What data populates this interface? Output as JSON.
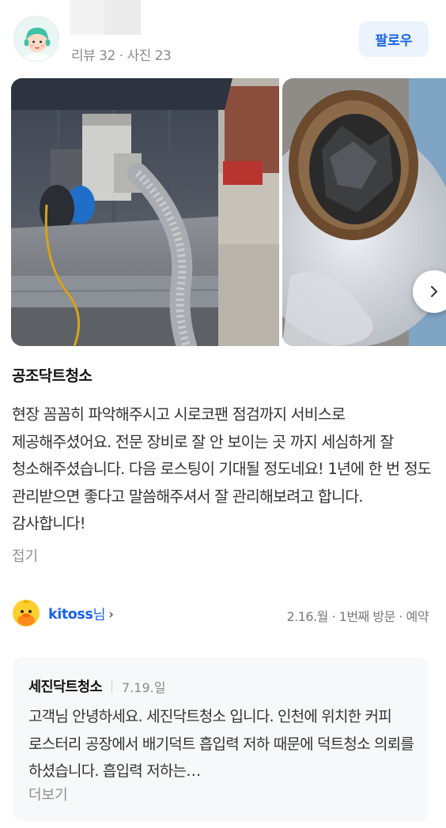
{
  "header": {
    "stats": "리뷰 32 · 사진 23",
    "follow_label": "팔로우"
  },
  "photos": {
    "next_icon": "chevron-right-icon"
  },
  "review": {
    "title": "공조닥트청소",
    "body": "현장 꼼꼼히 파악해주시고 시로코팬 점검까지 서비스로 제공해주셨어요. 전문 장비로 잘 안 보이는 곳 까지 세심하게 잘 청소해주셨습니다. 다음 로스팅이 기대될 정도네요! 1년에 한 번 정도 관리받으면 좋다고 말씀해주셔서 잘 관리해보려고 합니다. 감사합니다!",
    "fold_label": "접기"
  },
  "meta": {
    "user_name": "kitoss",
    "user_suffix": "님",
    "visit_info": "2.16.월 · 1번째 방문 · 예약"
  },
  "reply": {
    "name": "세진닥트청소",
    "date": "7.19.일",
    "body": "고객님 안녕하세요. 세진닥트청소 입니다. 인천에 위치한 커피 로스터리 공장에서 배기덕트 흡입력 저하 때문에 덕트청소 의뢰를 하셨습니다. 흡입력 저하는…",
    "more_label": "더보기"
  },
  "colors": {
    "accent": "#1a64e8",
    "follow_bg": "#ecf3fd",
    "reply_bg": "#f7f8fa"
  }
}
